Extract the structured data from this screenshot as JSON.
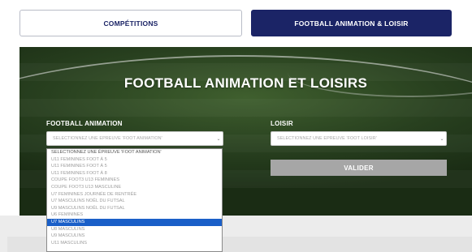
{
  "tabs": [
    {
      "label": "COMPÉTITIONS",
      "active": false
    },
    {
      "label": "FOOTBALL ANIMATION & LOISIR",
      "active": true
    }
  ],
  "hero": {
    "title": "FOOTBALL ANIMATION ET LOISIRS"
  },
  "football_animation": {
    "label": "FOOTBALL ANIMATION",
    "select_value": "SELECTIONNEZ UNE ÉPREUVE 'FOOT ANIMATION'"
  },
  "loisir": {
    "label": "LOISIR",
    "select_value": "SELECTIONNEZ UNE ÉPREUVE 'FOOT LOISIR'",
    "button_label": "VALIDER"
  },
  "dropdown": {
    "options": [
      "SELECTIONNEZ UNE ÉPREUVE 'FOOT ANIMATION'",
      "U11 FEMININES FOOT À 5",
      "U11 FEMININES FOOT À 5",
      "U11 FEMININES FOOT À 8",
      "COUPE FOOT3 U13 FEMININES",
      "COUPE FOOT3 U13 MASCULINE",
      "U7 FEMININES JOURNÉE DE RENTRÉE",
      "U7 MASCULINS NOËL DU FUTSAL",
      "U9 MASCULINS NOËL DU FUTSAL",
      "U6 FEMININES",
      "U7 MASCULINS",
      "U8 MASCULINS",
      "U9 MASCULINS",
      "U11 MASCULINS"
    ],
    "selected_index": 10
  },
  "colors": {
    "navy": "#1b2466",
    "selection_blue": "#1a5fc8",
    "button_gray": "#a6a6a6"
  }
}
